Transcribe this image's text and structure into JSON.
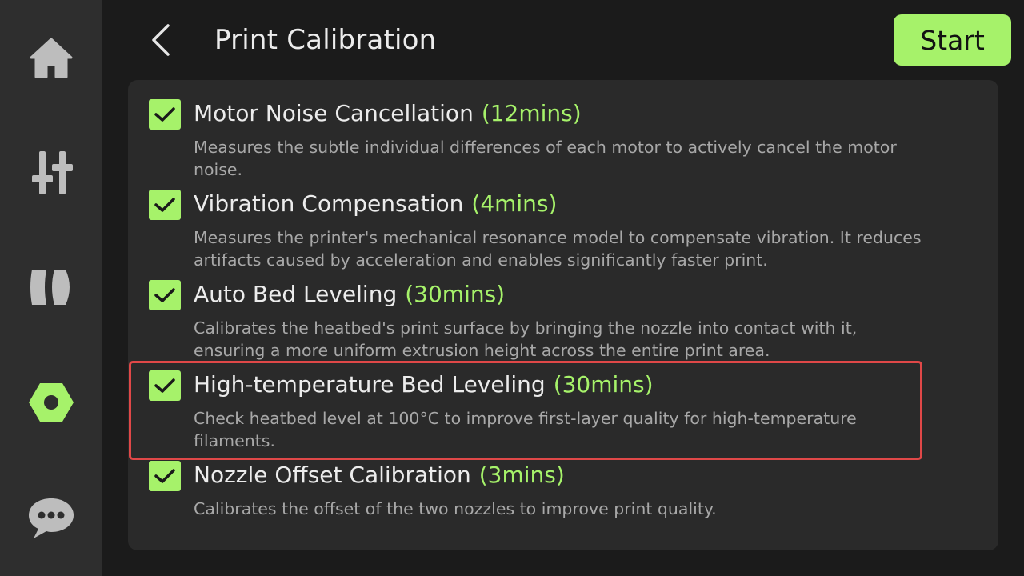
{
  "sidebar": {
    "items": [
      {
        "icon": "home-icon",
        "active": false
      },
      {
        "icon": "sliders-icon",
        "active": false
      },
      {
        "icon": "filament-spool-icon",
        "active": false
      },
      {
        "icon": "hex-nut-icon",
        "active": true
      },
      {
        "icon": "chat-bubble-icon",
        "active": false
      }
    ]
  },
  "header": {
    "back_icon": "chevron-left-icon",
    "title": "Print Calibration",
    "start_label": "Start"
  },
  "calibrations": [
    {
      "title": "Motor Noise Cancellation",
      "time": "(12mins)",
      "description": "Measures the subtle individual differences of each motor to actively cancel the motor noise.",
      "checked": true
    },
    {
      "title": "Vibration Compensation",
      "time": "(4mins)",
      "description": "Measures the printer's mechanical resonance model to compensate vibration. It reduces artifacts caused by acceleration and enables significantly faster print.",
      "checked": true
    },
    {
      "title": "Auto Bed Leveling",
      "time": "(30mins)",
      "description": "Calibrates the heatbed's print surface by bringing the nozzle into contact with it, ensuring a more uniform extrusion height across the entire print area.",
      "checked": true
    },
    {
      "title": "High-temperature Bed Leveling",
      "time": "(30mins)",
      "description": "Check heatbed level at 100°C to improve first-layer quality for high-temperature filaments.",
      "checked": true,
      "highlighted": true
    },
    {
      "title": "Nozzle Offset Calibration",
      "time": "(3mins)",
      "description": "Calibrates the offset of the two nozzles to improve print quality.",
      "checked": true
    }
  ],
  "colors": {
    "accent": "#a6f26a",
    "highlight": "#e04848",
    "icon_inactive": "#bdbdbd"
  }
}
